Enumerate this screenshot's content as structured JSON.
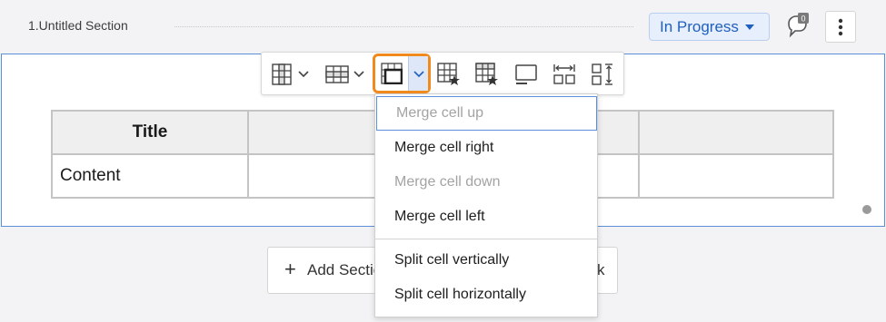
{
  "section": {
    "title": "1.Untitled Section",
    "status_label": "In Progress",
    "comment_count": "0"
  },
  "table": {
    "header_row": [
      "Title",
      "",
      "",
      ""
    ],
    "body_row": [
      "Content",
      "",
      "",
      ""
    ]
  },
  "toolbar": {
    "items": [
      {
        "icon": "insert-column-icon",
        "has_dropdown": true
      },
      {
        "icon": "insert-row-icon",
        "has_dropdown": true
      },
      {
        "icon": "merge-cells-icon",
        "has_dropdown": true,
        "active": true
      },
      {
        "icon": "column-header-icon"
      },
      {
        "icon": "row-header-icon"
      },
      {
        "icon": "table-caption-icon"
      },
      {
        "icon": "distribute-columns-icon"
      },
      {
        "icon": "distribute-rows-icon"
      }
    ],
    "highlight_color": "#f08a1c"
  },
  "merge_menu": {
    "items": [
      {
        "label": "Merge cell up",
        "disabled": true,
        "focused": true
      },
      {
        "label": "Merge cell right",
        "disabled": false
      },
      {
        "label": "Merge cell down",
        "disabled": true
      },
      {
        "label": "Merge cell left",
        "disabled": false
      },
      {
        "label": "Split cell vertically",
        "disabled": false
      },
      {
        "label": "Split cell horizontally",
        "disabled": false
      }
    ]
  },
  "add_section": {
    "label": "Add Section",
    "trailing_text": "k"
  },
  "colors": {
    "accent": "#1f5fbf",
    "frame_border": "#5b8fd9"
  }
}
